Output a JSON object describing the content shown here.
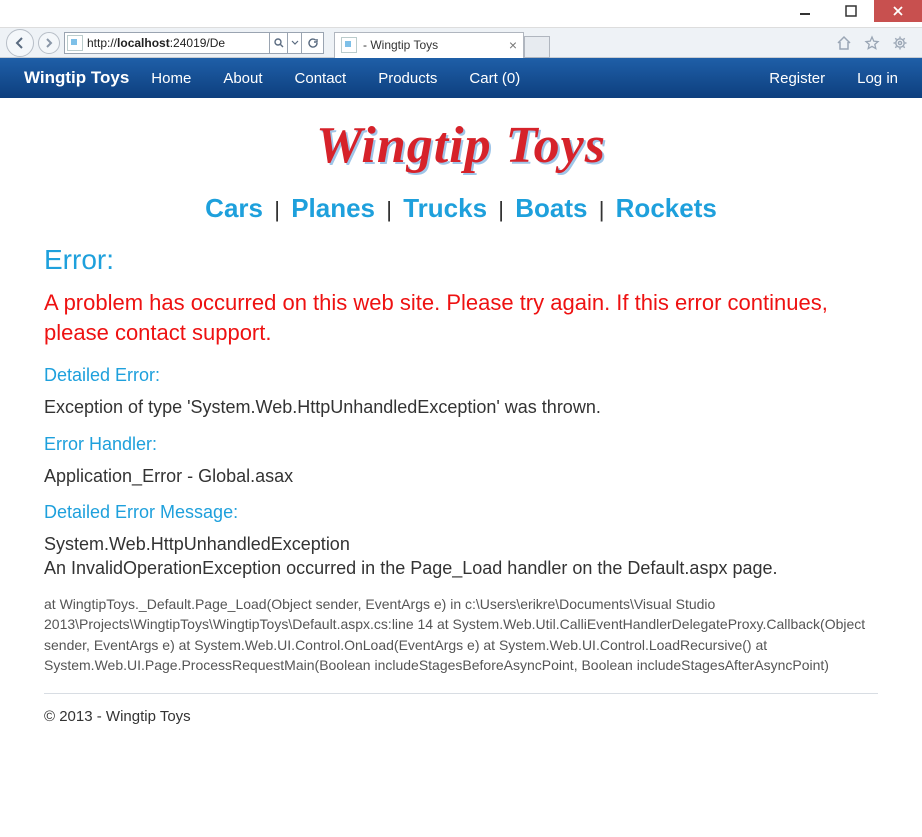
{
  "window": {
    "url_scheme": "http://",
    "url_host": "localhost",
    "url_rest": ":24019/De",
    "tab_title": " - Wingtip Toys"
  },
  "nav": {
    "brand": "Wingtip Toys",
    "links": [
      "Home",
      "About",
      "Contact",
      "Products",
      "Cart (0)"
    ],
    "right": [
      "Register",
      "Log in"
    ]
  },
  "logo": "Wingtip Toys",
  "categories": [
    "Cars",
    "Planes",
    "Trucks",
    "Boats",
    "Rockets"
  ],
  "category_sep": "|",
  "error": {
    "title": "Error:",
    "message": "A problem has occurred on this web site. Please try again. If this error continues, please contact support.",
    "detailed_label": "Detailed Error:",
    "detailed_text": "Exception of type 'System.Web.HttpUnhandledException' was thrown.",
    "handler_label": "Error Handler:",
    "handler_text": "Application_Error - Global.asax",
    "detailed_msg_label": "Detailed Error Message:",
    "detailed_msg_text": "System.Web.HttpUnhandledException\nAn InvalidOperationException occurred in the Page_Load handler on the Default.aspx page.",
    "stack_trace": "at WingtipToys._Default.Page_Load(Object sender, EventArgs e) in c:\\Users\\erikre\\Documents\\Visual Studio 2013\\Projects\\WingtipToys\\WingtipToys\\Default.aspx.cs:line 14 at System.Web.Util.CalliEventHandlerDelegateProxy.Callback(Object sender, EventArgs e) at System.Web.UI.Control.OnLoad(EventArgs e) at System.Web.UI.Control.LoadRecursive() at System.Web.UI.Page.ProcessRequestMain(Boolean includeStagesBeforeAsyncPoint, Boolean includeStagesAfterAsyncPoint)"
  },
  "footer": "© 2013 - Wingtip Toys"
}
